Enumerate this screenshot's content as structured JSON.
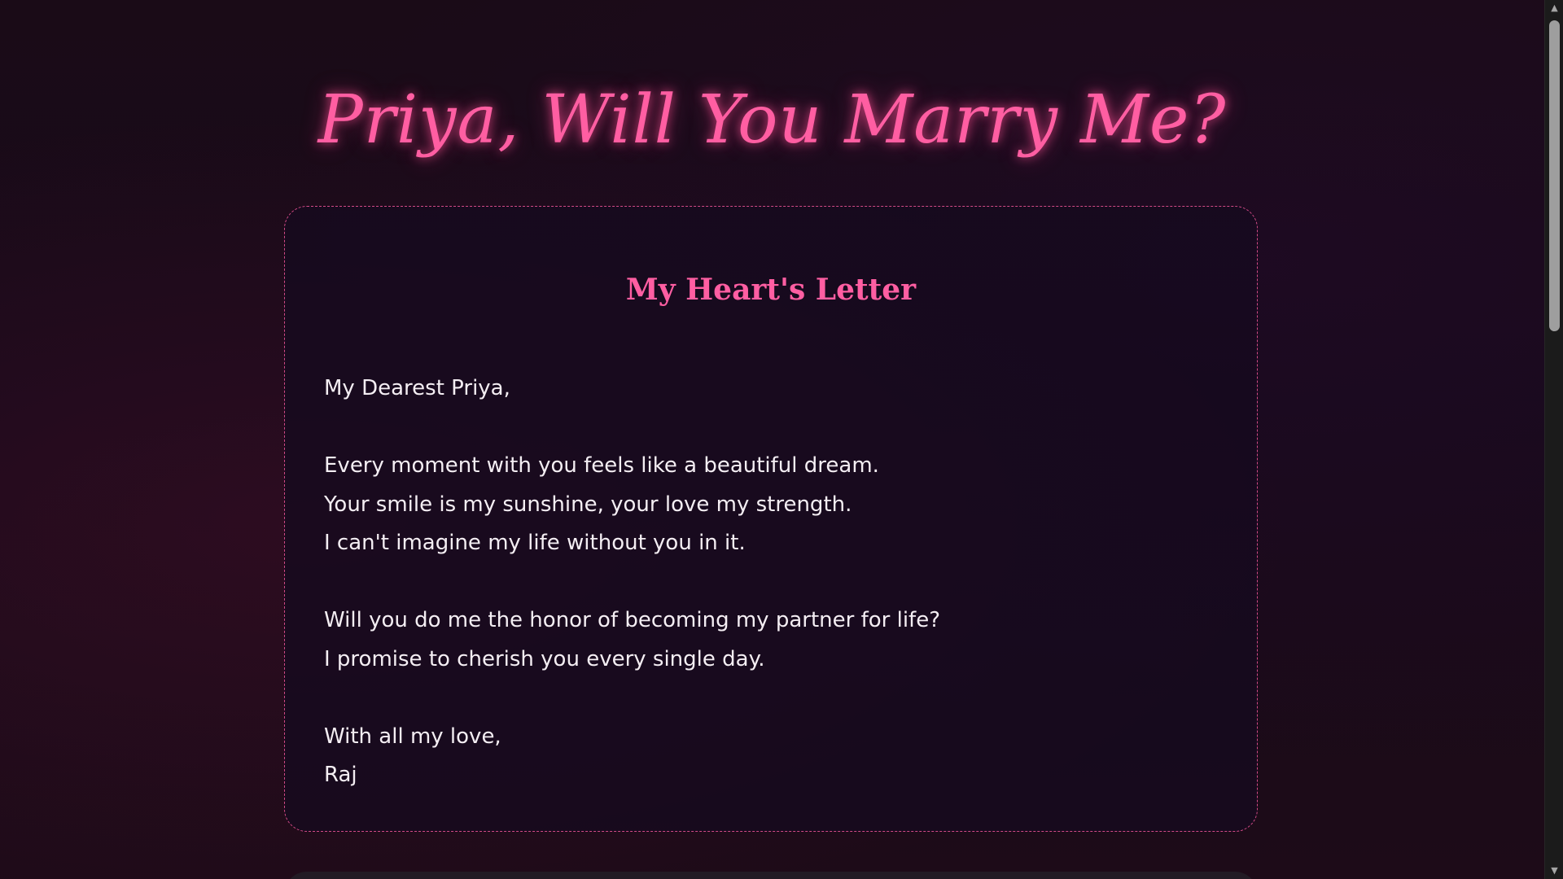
{
  "header": {
    "title": "Priya, Will You Marry Me?"
  },
  "letter": {
    "heading": "My Heart's Letter",
    "greeting": "My Dearest Priya,",
    "paragraph1": [
      "Every moment with you feels like a beautiful dream.",
      "Your smile is my sunshine, your love my strength.",
      "I can't imagine my life without you in it."
    ],
    "paragraph2": [
      "Will you do me the honor of becoming my partner for life?",
      "I promise to cherish you every single day."
    ],
    "closing": "With all my love,",
    "signature": "Raj"
  },
  "scrollbar": {
    "up_icon": "▲",
    "down_icon": "▼",
    "scroll_position": 0
  },
  "colors": {
    "accent": "#ff5ea2",
    "card_border": "#d24a86",
    "text": "#f4eef3",
    "background": "#1a0b16"
  }
}
